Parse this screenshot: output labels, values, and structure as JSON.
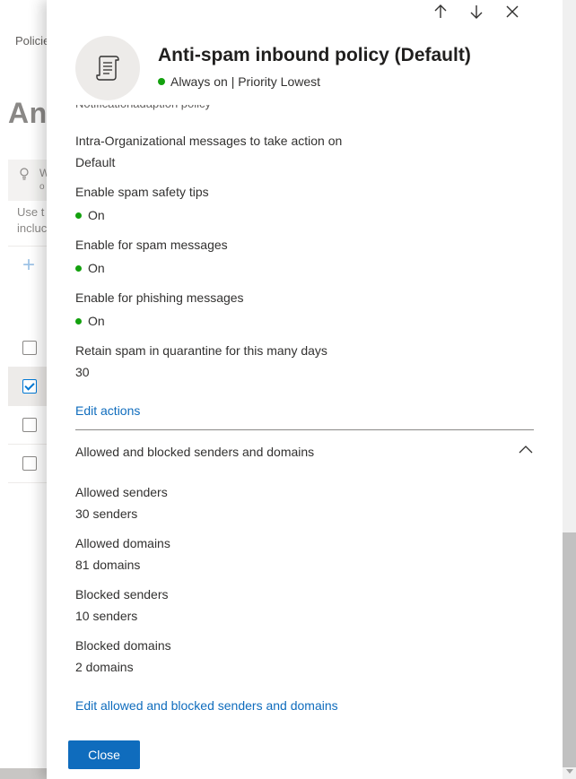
{
  "background": {
    "breadcrumb": "Policie",
    "title": "Ant",
    "tip_line1": "W",
    "tip_line2": "o",
    "desc_line1": "Use t",
    "desc_line2": "incluc"
  },
  "panel": {
    "title": "Anti-spam inbound policy (Default)",
    "status": "Always on | Priority Lowest",
    "clipped_text": "Notificationadaption policy",
    "fields": [
      {
        "label": "Intra-Organizational messages to take action on",
        "value": "Default",
        "dot": false
      },
      {
        "label": "Enable spam safety tips",
        "value": "On",
        "dot": true
      },
      {
        "label": "Enable for spam messages",
        "value": "On",
        "dot": true
      },
      {
        "label": "Enable for phishing messages",
        "value": "On",
        "dot": true
      },
      {
        "label": "Retain spam in quarantine for this many days",
        "value": "30",
        "dot": false
      }
    ],
    "edit_actions": "Edit actions",
    "section_title": "Allowed and blocked senders and domains",
    "sender_fields": [
      {
        "label": "Allowed senders",
        "value": "30 senders"
      },
      {
        "label": "Allowed domains",
        "value": "81 domains"
      },
      {
        "label": "Blocked senders",
        "value": "10 senders"
      },
      {
        "label": "Blocked domains",
        "value": "2 domains"
      }
    ],
    "edit_senders": "Edit allowed and blocked senders and domains",
    "close_label": "Close"
  },
  "colors": {
    "accent": "#0f6cbd",
    "status_green": "#13a10e"
  },
  "icons": {
    "previous": "arrow-up-icon",
    "next": "arrow-down-icon",
    "close": "close-icon",
    "policy": "scroll-icon",
    "collapse": "chevron-up-icon"
  }
}
